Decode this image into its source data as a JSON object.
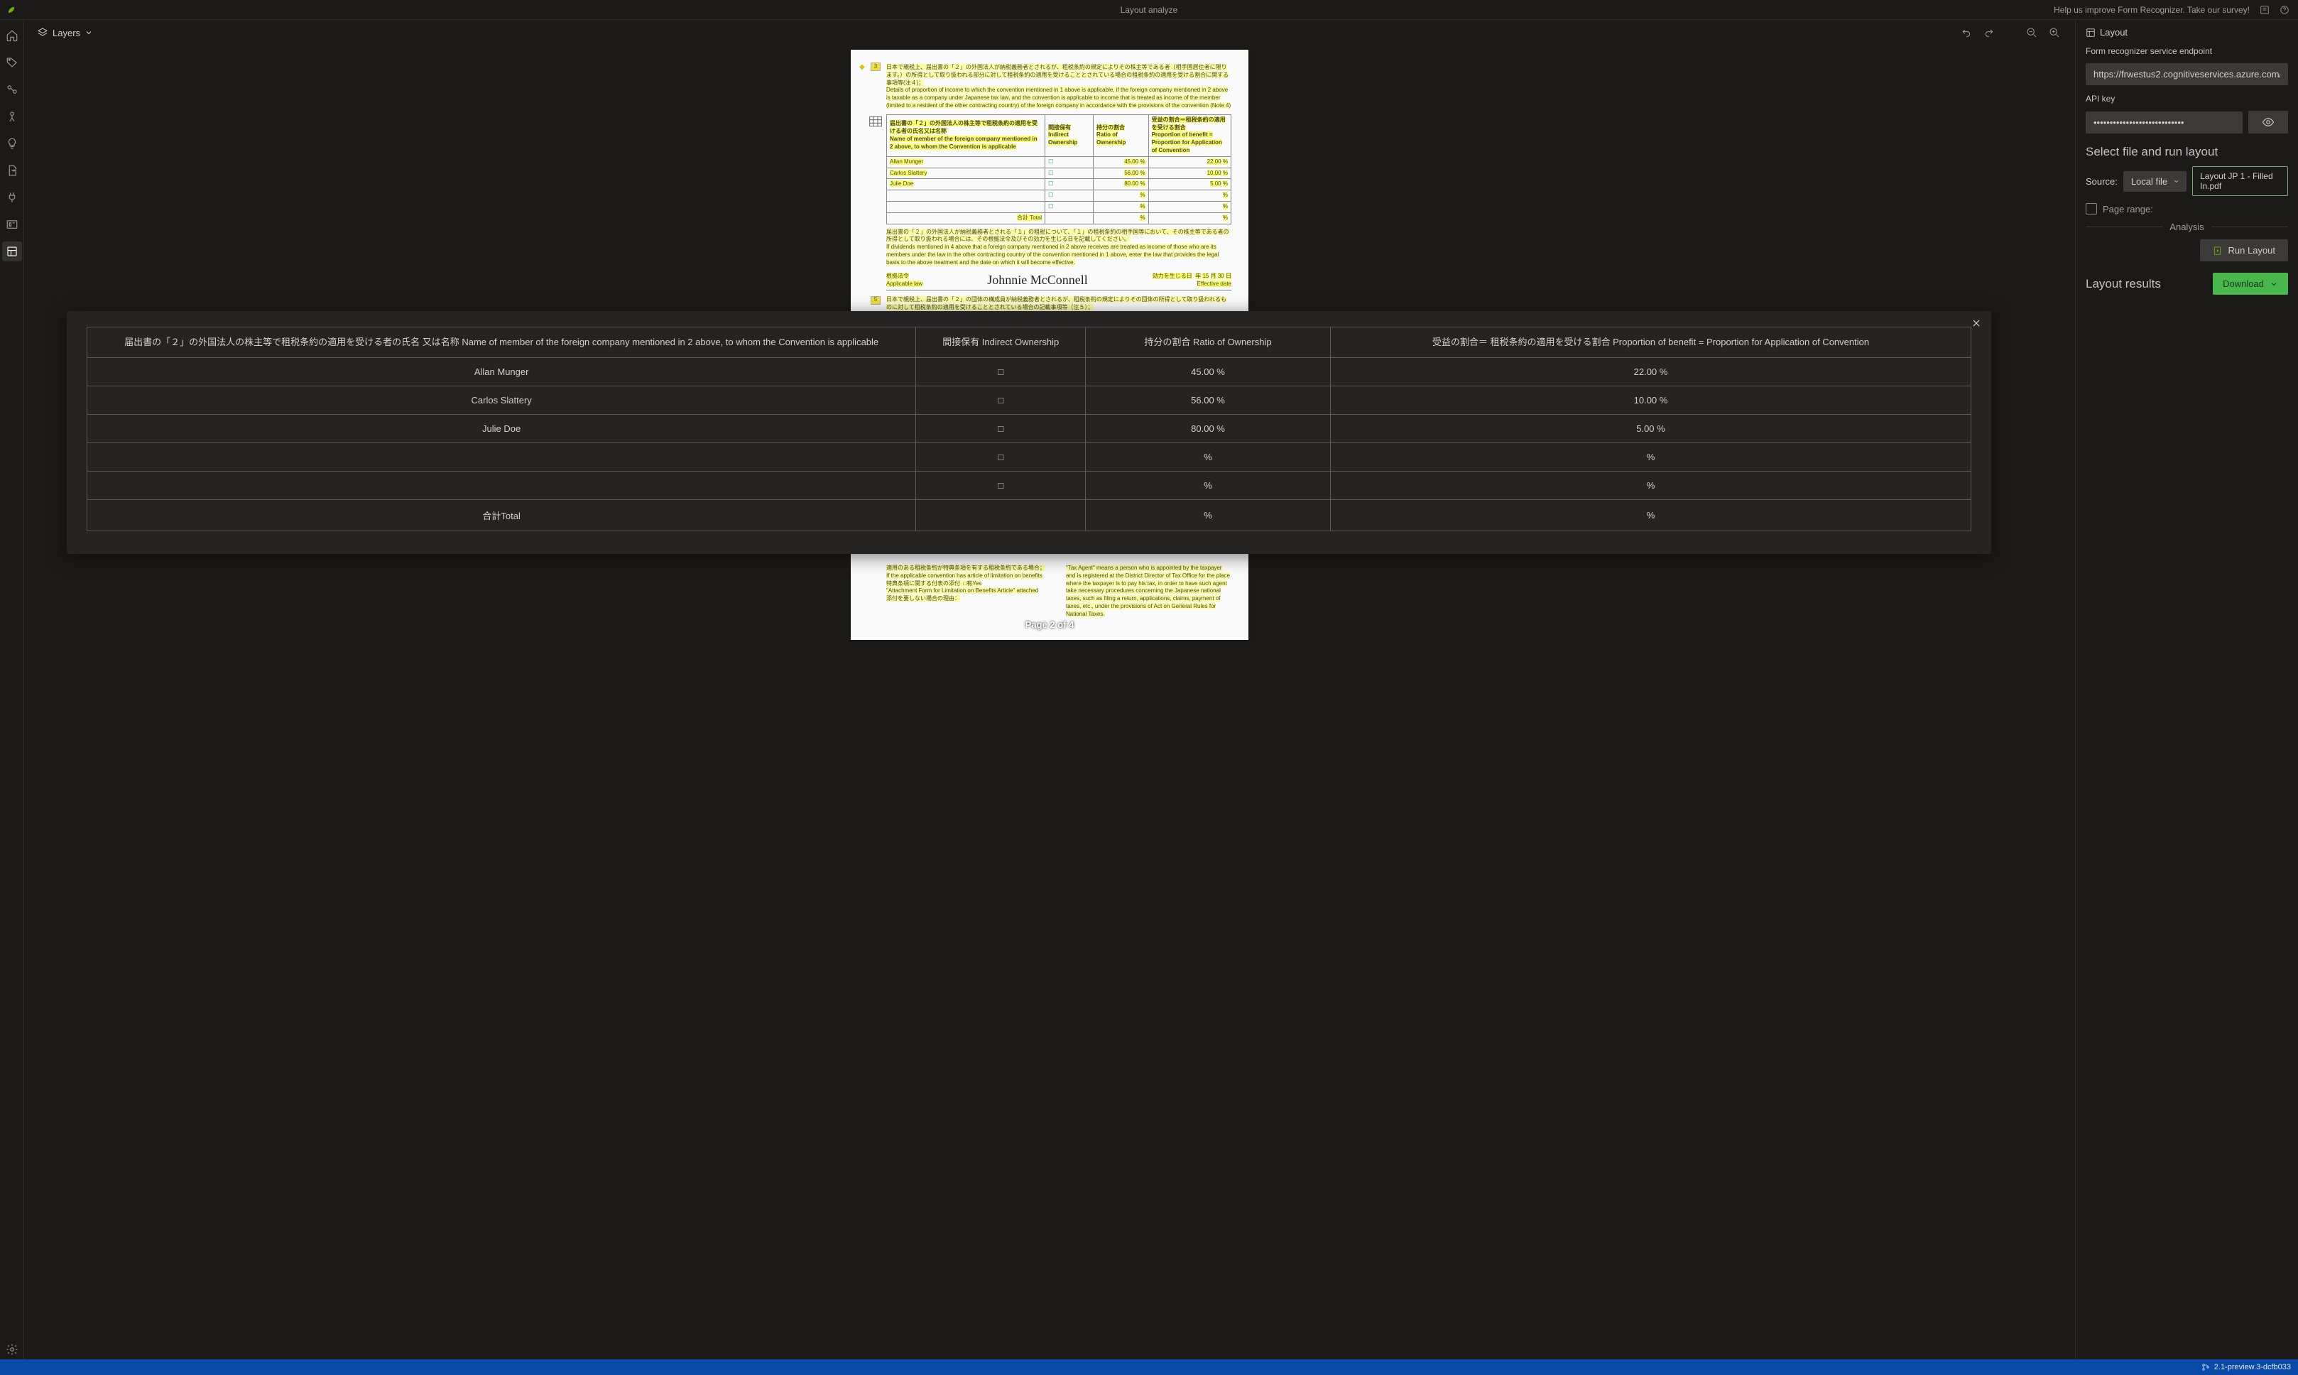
{
  "topbar": {
    "title": "Layout analyze",
    "survey_text": "Help us improve Form Recognizer. Take our survey!"
  },
  "toolbar": {
    "layers_label": "Layers"
  },
  "rightpanel": {
    "header": "Layout",
    "endpoint_label": "Form recognizer service endpoint",
    "endpoint_value": "https://frwestus2.cognitiveservices.azure.com/",
    "apikey_label": "API key",
    "apikey_value": "••••••••••••••••••••••••••••",
    "select_file_section": "Select file and run layout",
    "source_label": "Source:",
    "source_value": "Local file",
    "file_name": "Layout JP 1 - Filled In.pdf",
    "page_range_label": "Page range:",
    "analysis_divider": "Analysis",
    "run_layout_btn": "Run Layout",
    "results_label": "Layout results",
    "download_btn": "Download"
  },
  "doc": {
    "page_indicator": "Page 2 of 4",
    "signature": "Johnnie McConnell",
    "table_rows": [
      {
        "name": "Allan Munger",
        "ratio": "45.00",
        "benefit": "22.00"
      },
      {
        "name": "Carlos Slattery",
        "ratio": "56.00",
        "benefit": "10.00"
      },
      {
        "name": "Julie Doe",
        "ratio": "80.00",
        "benefit": "5.00"
      }
    ]
  },
  "overlay": {
    "headers": {
      "name": "届出書の「２」の外国法人の株主等で租税条約の適用を受ける者の氏名 又は名称 Name of member of the foreign company mentioned in 2 above, to whom the Convention is applicable",
      "indirect": "間接保有 Indirect Ownership",
      "ratio": "持分の割合 Ratio of Ownership",
      "benefit": "受益の割合＝ 租税条約の適用を受ける割合 Proportion of benefit = Proportion for Application of Convention"
    },
    "rows": [
      {
        "name": "Allan Munger",
        "indirect": "□",
        "ratio": "45.00 %",
        "benefit": "22.00 %"
      },
      {
        "name": "Carlos Slattery",
        "indirect": "□",
        "ratio": "56.00 %",
        "benefit": "10.00 %"
      },
      {
        "name": "Julie Doe",
        "indirect": "□",
        "ratio": "80.00 %",
        "benefit": "5.00 %"
      },
      {
        "name": "",
        "indirect": "□",
        "ratio": "%",
        "benefit": "%"
      },
      {
        "name": "",
        "indirect": "□",
        "ratio": "%",
        "benefit": "%"
      },
      {
        "name": "合計Total",
        "indirect": "",
        "ratio": "%",
        "benefit": "%"
      }
    ]
  },
  "statusbar": {
    "version": "2.1-preview.3-dcfb033"
  }
}
